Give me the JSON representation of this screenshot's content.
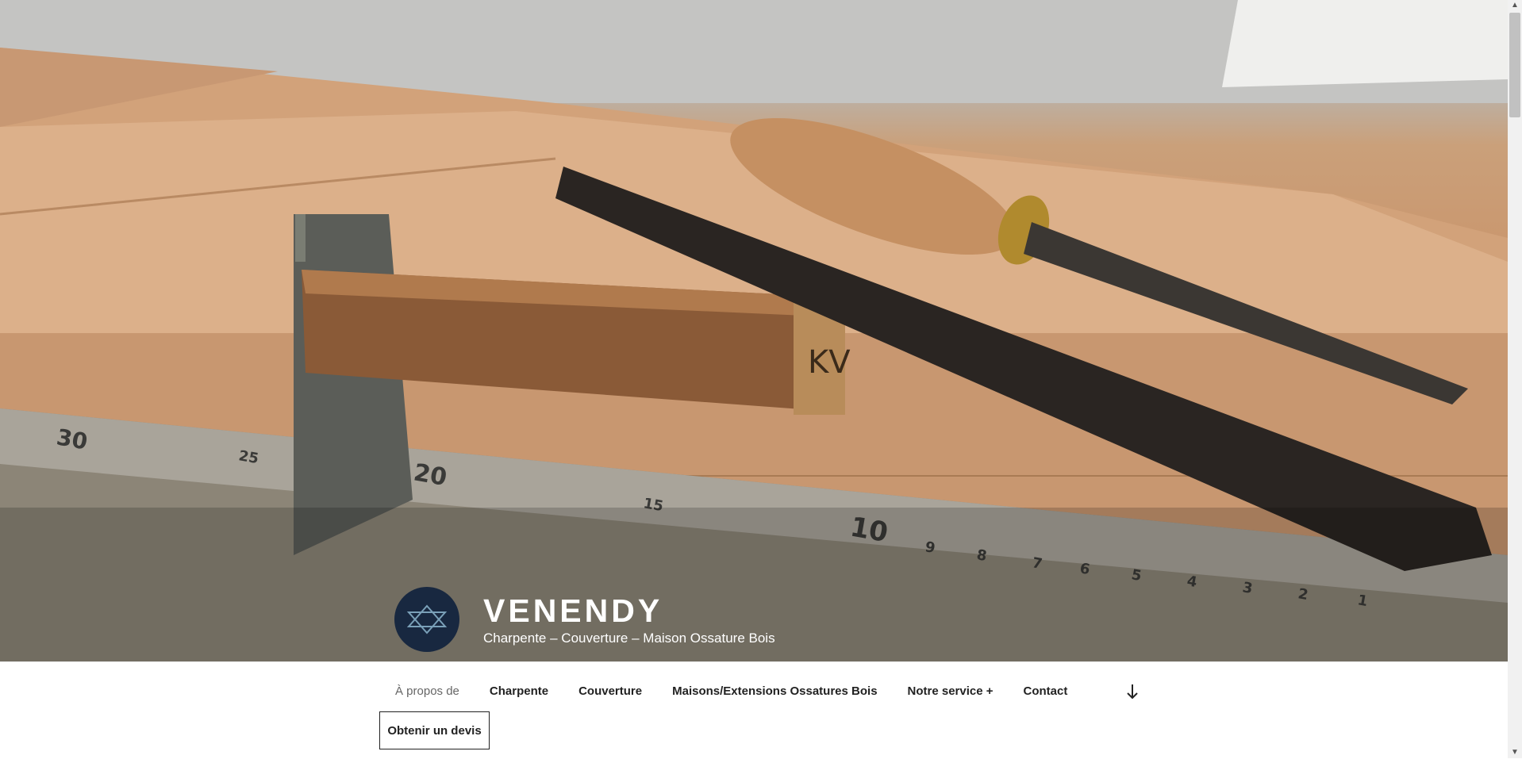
{
  "site": {
    "title": "VENENDY",
    "tagline": "Charpente – Couverture – Maison Ossature Bois"
  },
  "hero": {
    "image_subject": "carpentry tools on wood plank",
    "ruler_marks": [
      "30",
      "25",
      "20",
      "15",
      "10",
      "9",
      "8",
      "7",
      "6",
      "5",
      "4",
      "3",
      "2",
      "1"
    ],
    "tool_stamp": "KV"
  },
  "nav": {
    "items": [
      {
        "label": "À propos de",
        "current": true
      },
      {
        "label": "Charpente"
      },
      {
        "label": "Couverture"
      },
      {
        "label": "Maisons/Extensions Ossatures Bois"
      },
      {
        "label": "Notre service +"
      },
      {
        "label": "Contact"
      }
    ],
    "scroll_icon": "arrow-down-icon",
    "cta_label": "Obtenir un devis"
  },
  "colors": {
    "logo_bg": "#182840",
    "text_dark": "#222222",
    "text_current": "#666666"
  }
}
